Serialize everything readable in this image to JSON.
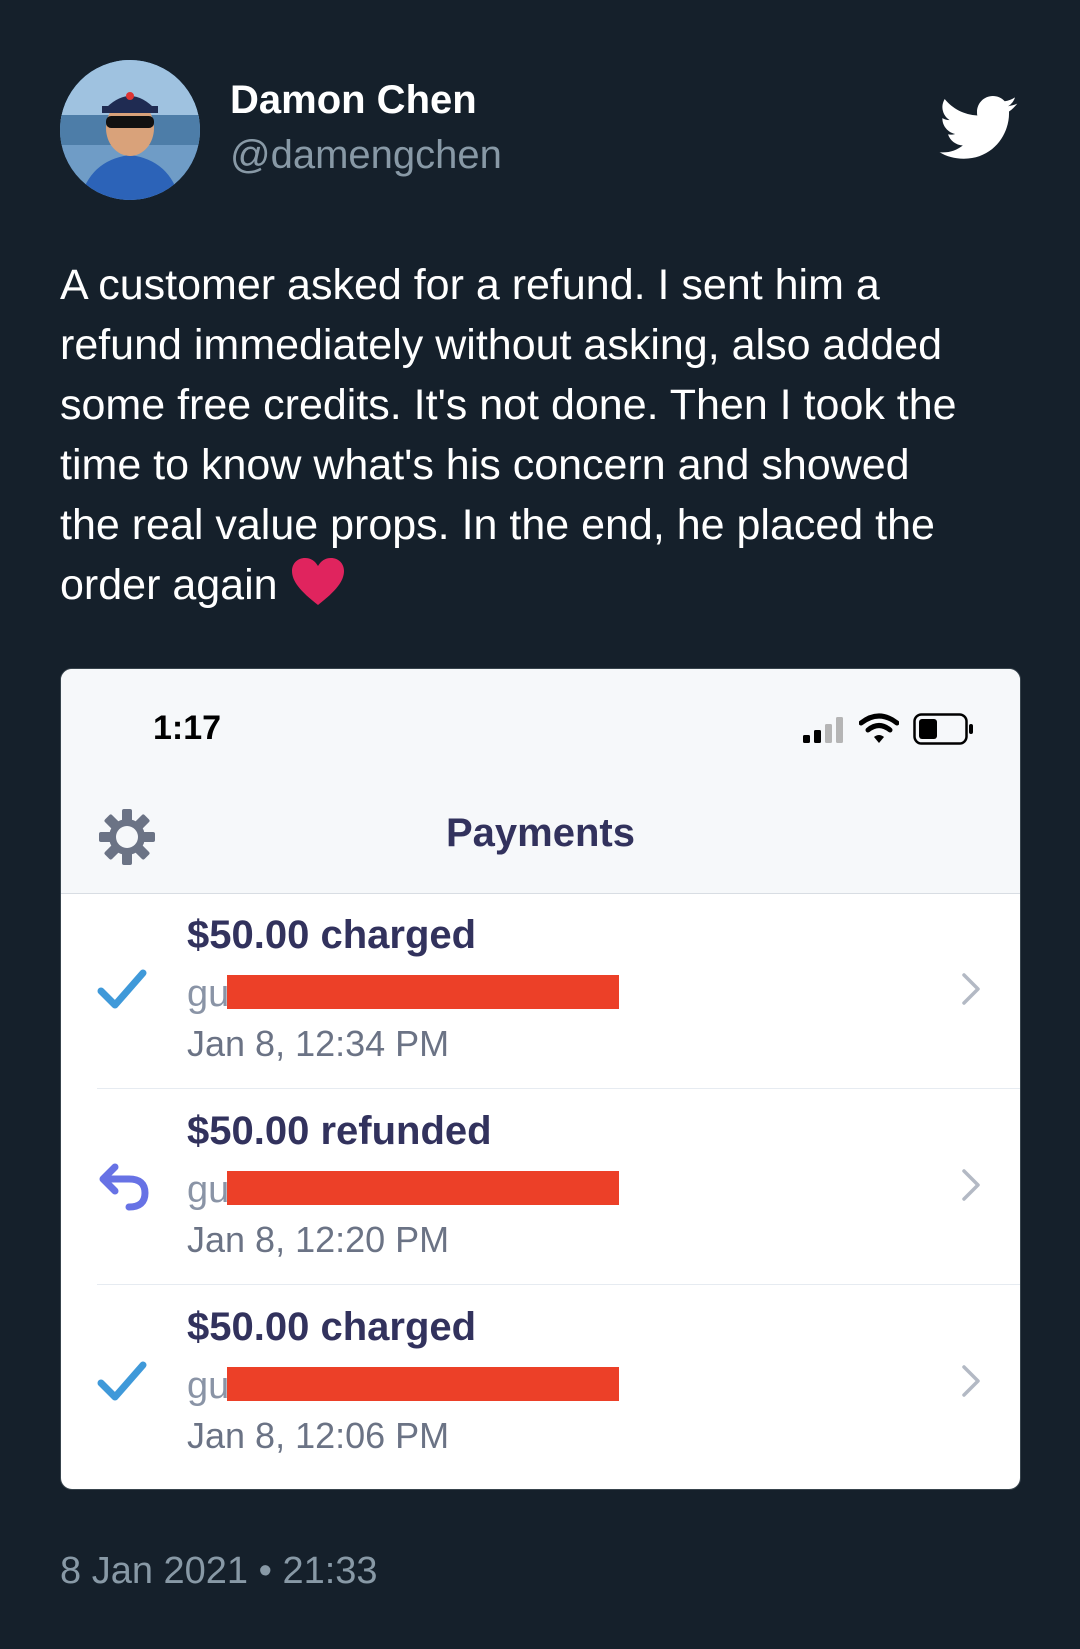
{
  "author": {
    "name": "Damon Chen",
    "handle": "@damengchen",
    "avatar_icon": "profile-photo"
  },
  "brand_icon": "twitter-bird-icon",
  "tweet": {
    "text": "A customer asked for a refund. I sent him a\nrefund immediately without asking, also added\nsome free credits. It's not done. Then I took the\ntime to know what's his concern and showed\nthe real value props. In the end, he placed the\norder again",
    "emoji": "heart-emoji"
  },
  "screenshot": {
    "status_bar": {
      "time": "1:17"
    },
    "nav": {
      "title": "Payments",
      "settings_icon": "gear-icon"
    },
    "payments": [
      {
        "title": "$50.00 charged",
        "email_prefix": "gu",
        "date": "Jan 8, 12:34 PM",
        "icon": "checkmark-icon",
        "icon_color": "#3f99d9"
      },
      {
        "title": "$50.00 refunded",
        "email_prefix": "gu",
        "date": "Jan 8, 12:20 PM",
        "icon": "refund-arrow-icon",
        "icon_color": "#6772e5"
      },
      {
        "title": "$50.00 charged",
        "email_prefix": "gu",
        "date": "Jan 8, 12:06 PM",
        "icon": "checkmark-icon",
        "icon_color": "#3f99d9"
      }
    ]
  },
  "timestamp": "8 Jan 2021 • 21:33",
  "colors": {
    "background": "#15202b",
    "secondary_text": "#8899a6",
    "redaction": "#ec4028",
    "heart": "#e0245e"
  }
}
